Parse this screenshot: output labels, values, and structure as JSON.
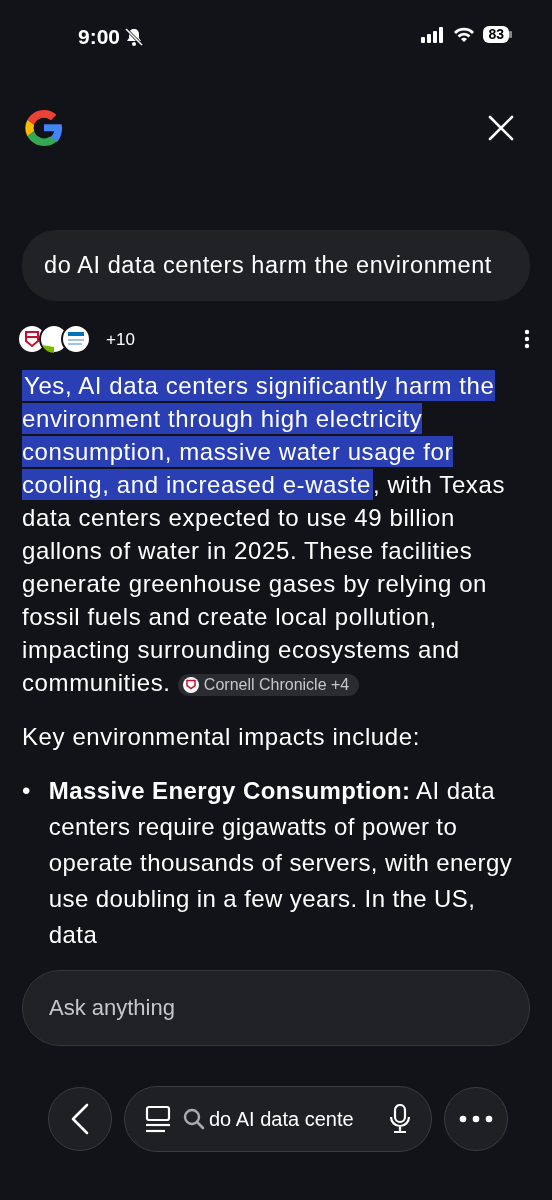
{
  "status_bar": {
    "time": "9:00",
    "battery": "83"
  },
  "query": "do AI data centers harm the environment",
  "sources": {
    "count": "+10"
  },
  "answer": {
    "highlighted": "Yes, AI data centers significantly harm the environment through high electricity consumption, massive water usage for cooling, and increased e-waste",
    "rest": ", with Texas data centers expected to use 49 billion gallons of water in 2025. These facilities generate greenhouse gases by relying on fossil fuels and create local pollution, impacting surrounding ecosystems and communities. ",
    "citation": "Cornell Chronicle +4"
  },
  "intro": "Key environmental impacts include:",
  "bullets": [
    {
      "marker": "•",
      "text": "**Massive Energy Consumption:** AI data centers require gigawatts of power to operate thousands of servers, with energy use doubling in a few years. In the US, data"
    }
  ],
  "ask_field": {
    "placeholder": "Ask anything"
  },
  "bottom_bar": {
    "search_text": "do AI data cente"
  }
}
